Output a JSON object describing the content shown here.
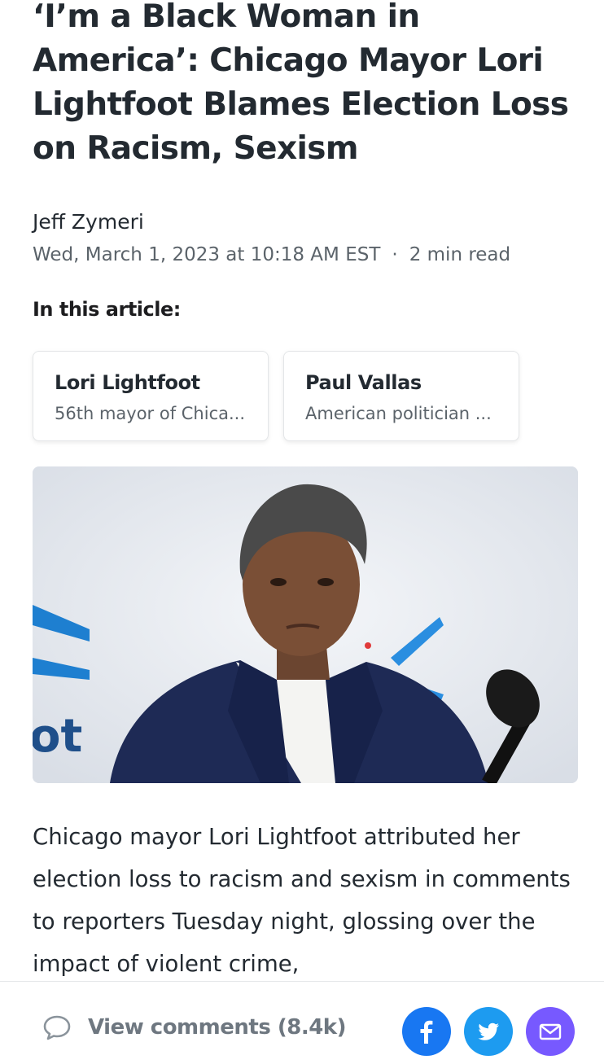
{
  "article": {
    "headline": "‘I’m a Black Woman in America’: Chicago Mayor Lori Lightfoot Blames Election Loss on Racism, Sexism",
    "author": "Jeff Zymeri",
    "date": "Wed, March 1, 2023 at 10:18 AM EST",
    "separator": "·",
    "read_time": "2 min read",
    "in_this_article_label": "In this article:",
    "entities": [
      {
        "name": "Lori Lightfoot",
        "description": "56th mayor of Chica..."
      },
      {
        "name": "Paul Vallas",
        "description": "American politician ..."
      }
    ],
    "photo_backdrop_text": "ot",
    "body": "Chicago mayor Lori Lightfoot attributed her election loss to racism and sexism in comments to reporters Tuesday night, glossing over the impact of violent crime,"
  },
  "bottom_bar": {
    "comments_label": "View comments (8.4k)",
    "share_buttons": [
      {
        "icon": "facebook-icon",
        "color": "#1877f2"
      },
      {
        "icon": "twitter-icon",
        "color": "#1d9bf0"
      },
      {
        "icon": "mail-icon",
        "color": "#7759ff"
      }
    ]
  },
  "colors": {
    "text_primary": "#232a31",
    "text_secondary": "#5b636a",
    "comments_text": "#6e7780"
  }
}
